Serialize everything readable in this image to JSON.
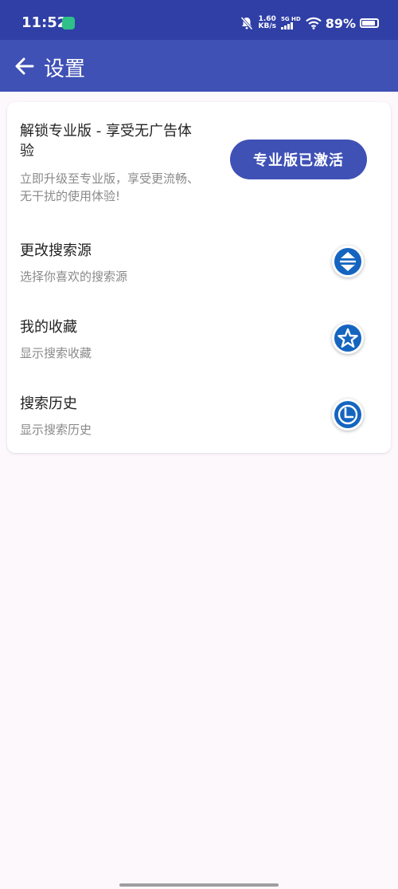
{
  "status": {
    "time": "11:52",
    "speed_value": "1.60",
    "speed_unit": "KB/s",
    "network": "5G HD",
    "battery_level": 89,
    "battery_text": "89%"
  },
  "header": {
    "title": "设置"
  },
  "pro": {
    "title": "解锁专业版 - 享受无广告体验",
    "description": "立即升级至专业版，享受更流畅、无干扰的使用体验!",
    "button_label": "专业版已激活"
  },
  "settings": [
    {
      "title": "更改搜索源",
      "subtitle": "选择你喜欢的搜索源",
      "icon": "swap-vertical-icon"
    },
    {
      "title": "我的收藏",
      "subtitle": "显示搜索收藏",
      "icon": "star-icon"
    },
    {
      "title": "搜索历史",
      "subtitle": "显示搜索历史",
      "icon": "clock-icon"
    }
  ],
  "colors": {
    "status_bar": "#2f3fa6",
    "app_bar": "#3f51b5",
    "accent": "#3f51b5",
    "icon_blue": "#1565c0"
  }
}
